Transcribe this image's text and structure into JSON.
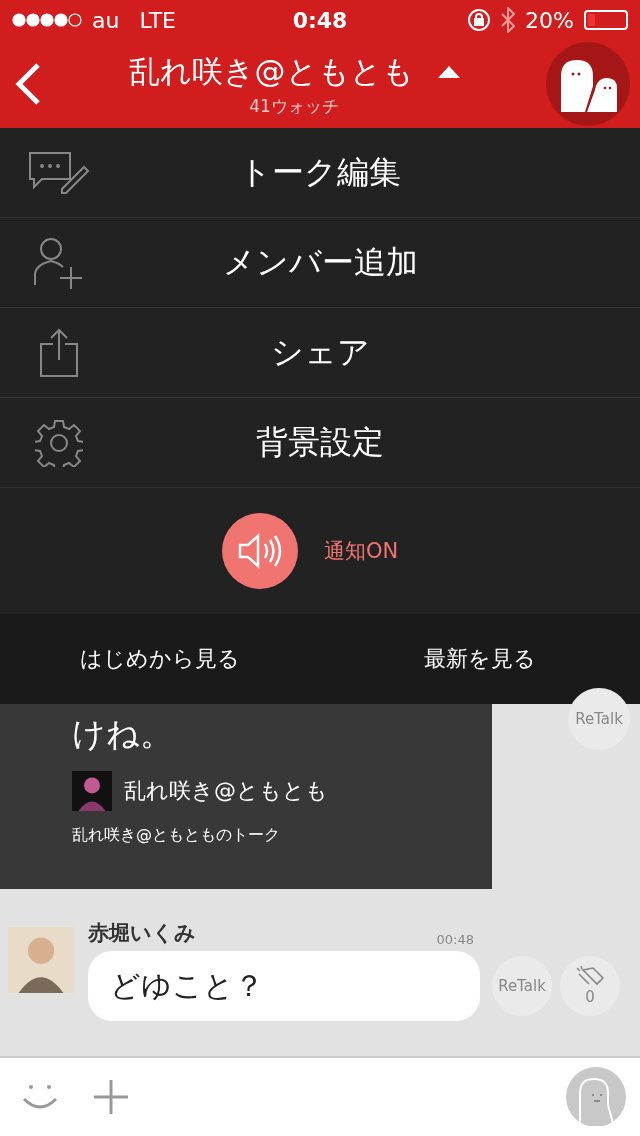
{
  "status_bar": {
    "carrier": "au",
    "network": "LTE",
    "time": "0:48",
    "battery": "20%"
  },
  "header": {
    "title": "乱れ咲き@ともとも",
    "subtitle": "41ウォッチ"
  },
  "menu": [
    {
      "kind": "edit",
      "label": "トーク編集"
    },
    {
      "kind": "add-member",
      "label": "メンバー追加"
    },
    {
      "kind": "share",
      "label": "シェア"
    },
    {
      "kind": "settings",
      "label": "背景設定"
    }
  ],
  "notification": {
    "label": "通知ON",
    "on": true
  },
  "jump_bar": [
    "はじめから見る",
    "最新を見る"
  ],
  "shared_card": {
    "text": "けね。",
    "author": "乱れ咲き@ともとも",
    "source": "乱れ咲き@ともとものトーク",
    "retalk": "ReTalk"
  },
  "message": {
    "sender": "赤堀いくみ",
    "time": "00:48",
    "text": "どゆこと？",
    "retalk": "ReTalk",
    "claps": "0"
  }
}
